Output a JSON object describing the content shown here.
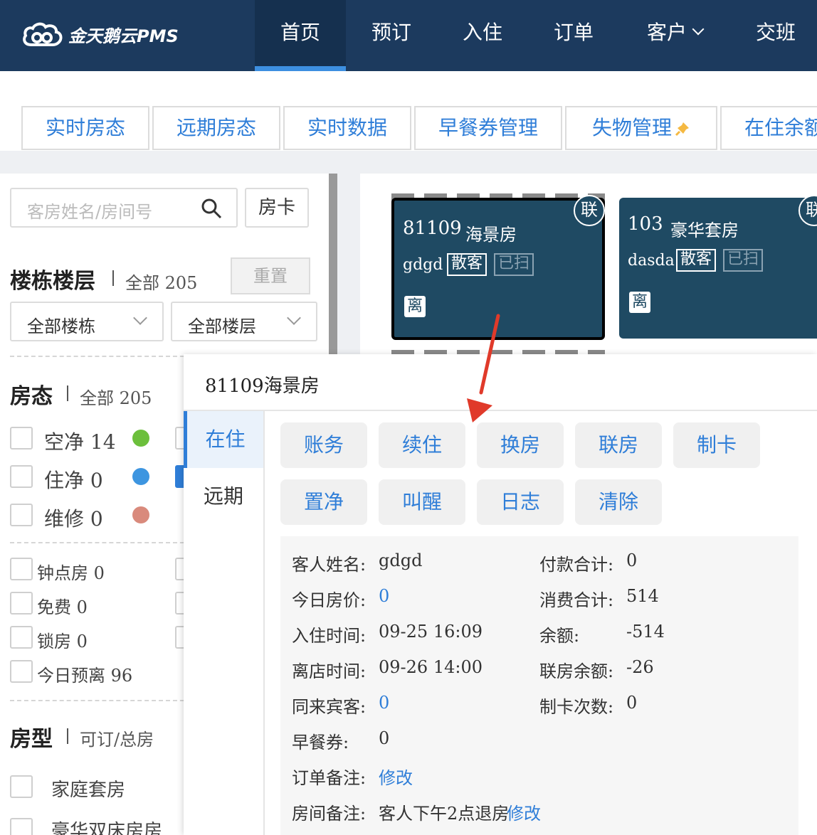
{
  "app": {
    "logo_text": "金天鹅云PMS"
  },
  "nav": {
    "items": [
      {
        "label": "首页"
      },
      {
        "label": "预订"
      },
      {
        "label": "入住"
      },
      {
        "label": "订单"
      },
      {
        "label": "客户"
      },
      {
        "label": "交班"
      }
    ]
  },
  "subtabs": [
    {
      "label": "实时房态"
    },
    {
      "label": "远期房态"
    },
    {
      "label": "实时数据"
    },
    {
      "label": "早餐券管理"
    },
    {
      "label": "失物管理"
    },
    {
      "label": "在住余额"
    }
  ],
  "sidebar": {
    "search_placeholder": "客房姓名/房间号",
    "room_card_button": "房卡",
    "building": {
      "title": "楼栋楼层",
      "summary": "全部 205",
      "reset": "重置",
      "building_select": "全部楼栋",
      "floor_select": "全部楼层"
    },
    "status": {
      "title": "房态",
      "summary": "全部 205",
      "items": [
        {
          "label": "空净 14",
          "color": "#6cbf3c"
        },
        {
          "label": "住净 0",
          "color": "#3d95e0"
        },
        {
          "label": "维修 0",
          "color": "#d98a7c"
        }
      ],
      "extras": [
        {
          "label": "钟点房 0"
        },
        {
          "label": "免费 0"
        },
        {
          "label": "锁房 0"
        },
        {
          "label": "今日预离 96"
        }
      ]
    },
    "room_type": {
      "title": "房型",
      "summary": "可订/总房",
      "items": [
        {
          "label": "家庭套房"
        },
        {
          "label": "豪华双床房房"
        }
      ]
    }
  },
  "rooms": [
    {
      "number": "81109",
      "type": "海景房",
      "guest": "gdgd",
      "tag1": "散客",
      "tag2": "已扫",
      "leave": "离",
      "badge": "联"
    },
    {
      "number": "103",
      "type": "豪华套房",
      "guest": "dasda",
      "tag1": "散客",
      "tag2": "已扫",
      "leave": "离",
      "badge": "联"
    }
  ],
  "popup": {
    "title": "81109海景房",
    "tabs": [
      {
        "label": "在住"
      },
      {
        "label": "远期"
      }
    ],
    "actions": [
      {
        "label": "账务"
      },
      {
        "label": "续住"
      },
      {
        "label": "换房"
      },
      {
        "label": "联房"
      },
      {
        "label": "制卡"
      },
      {
        "label": "置净"
      },
      {
        "label": "叫醒"
      },
      {
        "label": "日志"
      },
      {
        "label": "清除"
      }
    ],
    "info": {
      "guest_name_label": "客人姓名:",
      "guest_name": "gdgd",
      "price_label": "今日房价:",
      "price": "0",
      "checkin_label": "入住时间:",
      "checkin": "09-25 16:09",
      "checkout_label": "离店时间:",
      "checkout": "09-26 14:00",
      "companions_label": "同来宾客:",
      "companions": "0",
      "breakfast_label": "早餐券:",
      "breakfast": "0",
      "order_note_label": "订单备注:",
      "order_note_link": "修改",
      "room_note_label": "房间备注:",
      "room_note": "客人下午2点退房",
      "room_note_link": "修改",
      "payment_label": "付款合计:",
      "payment": "0",
      "consumption_label": "消费合计:",
      "consumption": "514",
      "balance_label": "余额:",
      "balance": "-514",
      "linked_balance_label": "联房余额:",
      "linked_balance": "-26",
      "card_count_label": "制卡次数:",
      "card_count": "0"
    }
  },
  "colors": {
    "nav_bg": "#1c3a5e",
    "accent": "#2f7ed8",
    "room_bg": "#1f4a63",
    "arrow": "#e03a2a"
  }
}
